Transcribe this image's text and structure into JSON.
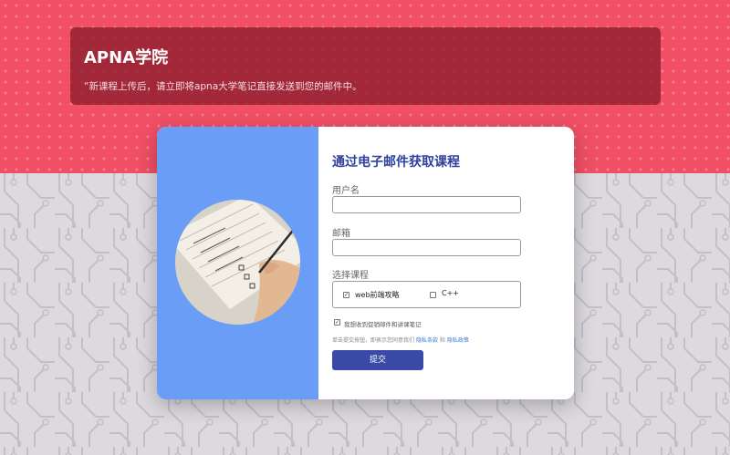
{
  "colors": {
    "top_bg": "#f04f65",
    "banner_bg": "#8c1e2d",
    "card_left_bg": "#6a9df6",
    "title_color": "#2f3f9e",
    "button_bg": "#3b4aa6",
    "link_color": "#3c7fd0"
  },
  "banner": {
    "title": "APNA学院",
    "subtitle": "“新课程上传后，请立即将apna大学笔记直接发送到您的邮件中。"
  },
  "form": {
    "title": "通过电子邮件获取课程",
    "username_label": "用户名",
    "username_value": "",
    "email_label": "邮箱",
    "email_value": "",
    "course_label": "选择课程",
    "courses": [
      {
        "label": "web前端攻略",
        "checked": true
      },
      {
        "label": "C++",
        "checked": false
      }
    ],
    "agree_label": "我想收到促销邮件和讲课笔记",
    "agree_checked": true,
    "note_prefix": "单击提交按钮，即表示您同意我们",
    "terms_link": "隐私条款",
    "note_and": "和",
    "privacy_link": "隐私政策",
    "submit_label": "提交"
  },
  "icons": {
    "check": "✓",
    "photo": "notebook-writing-photo"
  }
}
